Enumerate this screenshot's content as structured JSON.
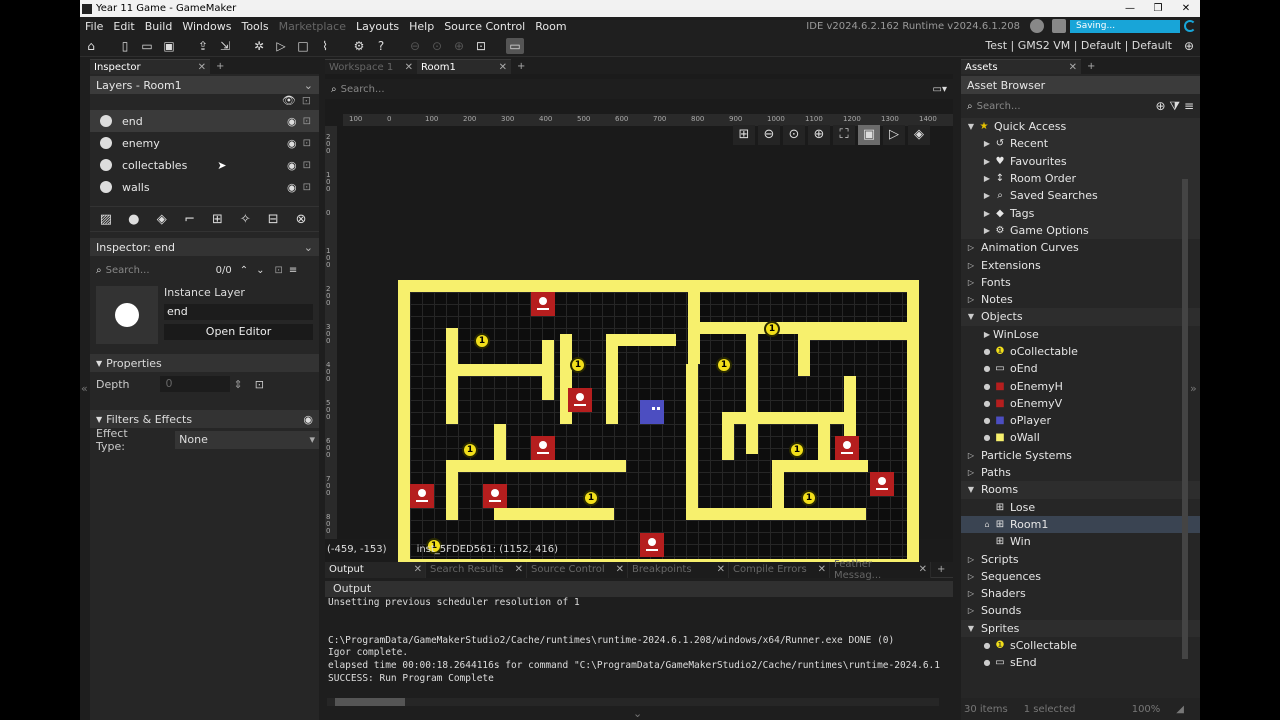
{
  "window": {
    "title": "Year 11 Game - GameMaker",
    "min": "—",
    "max": "❐",
    "close": "✕"
  },
  "menu": {
    "items": [
      "File",
      "Edit",
      "Build",
      "Windows",
      "Tools",
      "Marketplace",
      "Layouts",
      "Help",
      "Source Control",
      "Room"
    ],
    "version": "IDE v2024.6.2.162  Runtime v2024.6.1.208",
    "status": "Saving..."
  },
  "toolbar": {
    "config": "Test | GMS2 VM | Default | Default"
  },
  "inspector": {
    "tab": "Inspector",
    "layers_header": "Layers - Room1",
    "layers": [
      "end",
      "enemy",
      "collectables",
      "walls"
    ],
    "instance_header": "Inspector: end",
    "search_placeholder": "Search...",
    "search_count": "0/0",
    "layer_type": "Instance Layer",
    "layer_name": "end",
    "open_editor": "Open Editor",
    "properties": "Properties",
    "depth_label": "Depth",
    "depth_value": "0",
    "filters": "Filters & Effects",
    "effect_label": "Effect Type:",
    "effect_value": "None"
  },
  "center": {
    "tabs": [
      "Workspace 1",
      "Room1"
    ],
    "search_placeholder": "Search...",
    "ruler_h": [
      "100",
      "0",
      "100",
      "200",
      "300",
      "400",
      "500",
      "600",
      "700",
      "800",
      "900",
      "1000",
      "1100",
      "1200",
      "1300",
      "1400"
    ],
    "ruler_v": [
      "200",
      "100",
      "0",
      "100",
      "200",
      "300",
      "400",
      "500",
      "600",
      "700",
      "800"
    ],
    "cursor_coords": "(-459, -153)",
    "instance_coords": "inst_5FDED561: (1152, 416)",
    "coin_label": "1"
  },
  "output": {
    "tabs": [
      "Output",
      "Search Results",
      "Source Control",
      "Breakpoints",
      "Compile Errors",
      "Feather Messag..."
    ],
    "header": "Output",
    "lines": [
      "Unsetting previous scheduler resolution of 1",
      "",
      "",
      "C:\\ProgramData/GameMakerStudio2/Cache/runtimes\\runtime-2024.6.1.208/windows/x64/Runner.exe DONE (0)",
      "Igor complete.",
      "elapsed time 00:00:18.2644116s for command \"C:\\ProgramData/GameMakerStudio2/Cache/runtimes\\runtime-2024.6.1",
      "SUCCESS: Run Program Complete"
    ]
  },
  "assets": {
    "tab": "Assets",
    "header": "Asset Browser",
    "search_placeholder": "Search...",
    "tree": [
      {
        "label": "Quick Access",
        "level": 0,
        "arrow": "▼",
        "icon": "★",
        "cls": "cat"
      },
      {
        "label": "Recent",
        "level": 1,
        "arrow": "▶",
        "icon": "↺",
        "cls": "cat"
      },
      {
        "label": "Favourites",
        "level": 1,
        "arrow": "▶",
        "icon": "♥",
        "cls": "cat"
      },
      {
        "label": "Room Order",
        "level": 1,
        "arrow": "▶",
        "icon": "↕",
        "cls": "cat"
      },
      {
        "label": "Saved Searches",
        "level": 1,
        "arrow": "▶",
        "icon": "⌕",
        "cls": "cat"
      },
      {
        "label": "Tags",
        "level": 1,
        "arrow": "▶",
        "icon": "◆",
        "cls": "cat"
      },
      {
        "label": "Game Options",
        "level": 1,
        "arrow": "▶",
        "icon": "⚙",
        "cls": "cat"
      },
      {
        "label": "Animation Curves",
        "level": 0,
        "arrow": "▷",
        "icon": "",
        "cls": ""
      },
      {
        "label": "Extensions",
        "level": 0,
        "arrow": "▷",
        "icon": "",
        "cls": ""
      },
      {
        "label": "Fonts",
        "level": 0,
        "arrow": "▷",
        "icon": "",
        "cls": ""
      },
      {
        "label": "Notes",
        "level": 0,
        "arrow": "▷",
        "icon": "",
        "cls": ""
      },
      {
        "label": "Objects",
        "level": 0,
        "arrow": "▼",
        "icon": "",
        "cls": "cat"
      },
      {
        "label": "WinLose",
        "level": 1,
        "arrow": "▶",
        "icon": "",
        "cls": "cat2"
      },
      {
        "label": "oCollectable",
        "level": 1,
        "arrow": "●",
        "icon": "❶",
        "cls": "cat2"
      },
      {
        "label": "oEnd",
        "level": 1,
        "arrow": "●",
        "icon": "▭",
        "cls": "cat2"
      },
      {
        "label": "oEnemyH",
        "level": 1,
        "arrow": "●",
        "icon": "■",
        "cls": "cat2"
      },
      {
        "label": "oEnemyV",
        "level": 1,
        "arrow": "●",
        "icon": "■",
        "cls": "cat2"
      },
      {
        "label": "oPlayer",
        "level": 1,
        "arrow": "●",
        "icon": "■",
        "cls": "cat2"
      },
      {
        "label": "oWall",
        "level": 1,
        "arrow": "●",
        "icon": "■",
        "cls": "cat2"
      },
      {
        "label": "Particle Systems",
        "level": 0,
        "arrow": "▷",
        "icon": "",
        "cls": ""
      },
      {
        "label": "Paths",
        "level": 0,
        "arrow": "▷",
        "icon": "",
        "cls": ""
      },
      {
        "label": "Rooms",
        "level": 0,
        "arrow": "▼",
        "icon": "",
        "cls": "cat"
      },
      {
        "label": "Lose",
        "level": 1,
        "arrow": "",
        "icon": "⊞",
        "cls": "cat2"
      },
      {
        "label": "Room1",
        "level": 1,
        "arrow": "⌂",
        "icon": "⊞",
        "cls": "sel"
      },
      {
        "label": "Win",
        "level": 1,
        "arrow": "",
        "icon": "⊞",
        "cls": "cat2"
      },
      {
        "label": "Scripts",
        "level": 0,
        "arrow": "▷",
        "icon": "",
        "cls": ""
      },
      {
        "label": "Sequences",
        "level": 0,
        "arrow": "▷",
        "icon": "",
        "cls": ""
      },
      {
        "label": "Shaders",
        "level": 0,
        "arrow": "▷",
        "icon": "",
        "cls": ""
      },
      {
        "label": "Sounds",
        "level": 0,
        "arrow": "▷",
        "icon": "",
        "cls": ""
      },
      {
        "label": "Sprites",
        "level": 0,
        "arrow": "▼",
        "icon": "",
        "cls": "cat"
      },
      {
        "label": "sCollectable",
        "level": 1,
        "arrow": "●",
        "icon": "❶",
        "cls": "cat2"
      },
      {
        "label": "sEnd",
        "level": 1,
        "arrow": "●",
        "icon": "▭",
        "cls": "cat2"
      }
    ],
    "footer_items": "30 items",
    "footer_selected": "1 selected",
    "footer_zoom": "100%"
  },
  "colors": {
    "wall": "#f7f06d",
    "coin": "#f2df1a",
    "enemy": "#b51e1e",
    "player": "#4c4ec1",
    "accent": "#18a5d8"
  }
}
